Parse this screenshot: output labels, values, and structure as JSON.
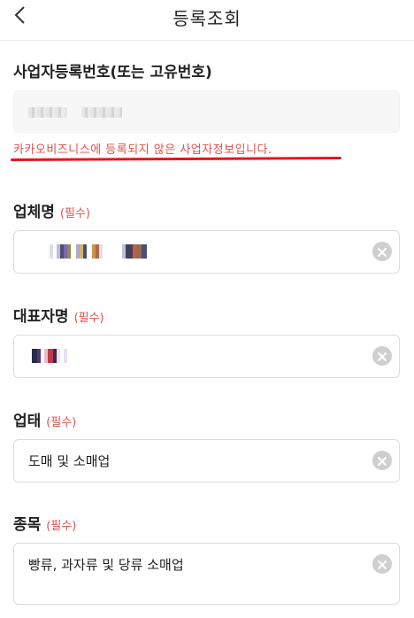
{
  "header": {
    "title": "등록조회",
    "back_icon": "chevron-left-icon"
  },
  "business_number": {
    "label": "사업자등록번호(또는 고유번호)",
    "error": "카카오비즈니스에 등록되지 않은 사업자정보입니다."
  },
  "fields": [
    {
      "label": "업체명",
      "required": "(필수)",
      "value": ""
    },
    {
      "label": "대표자명",
      "required": "(필수)",
      "value": ""
    },
    {
      "label": "업태",
      "required": "(필수)",
      "value": "도매 및 소매업"
    },
    {
      "label": "종목",
      "required": "(필수)",
      "value": "빵류, 과자류 및 당류 소매업"
    }
  ],
  "colors": {
    "error": "#e0524c",
    "underline": "#e8141c",
    "clear_icon_bg": "#cfcfcf"
  }
}
